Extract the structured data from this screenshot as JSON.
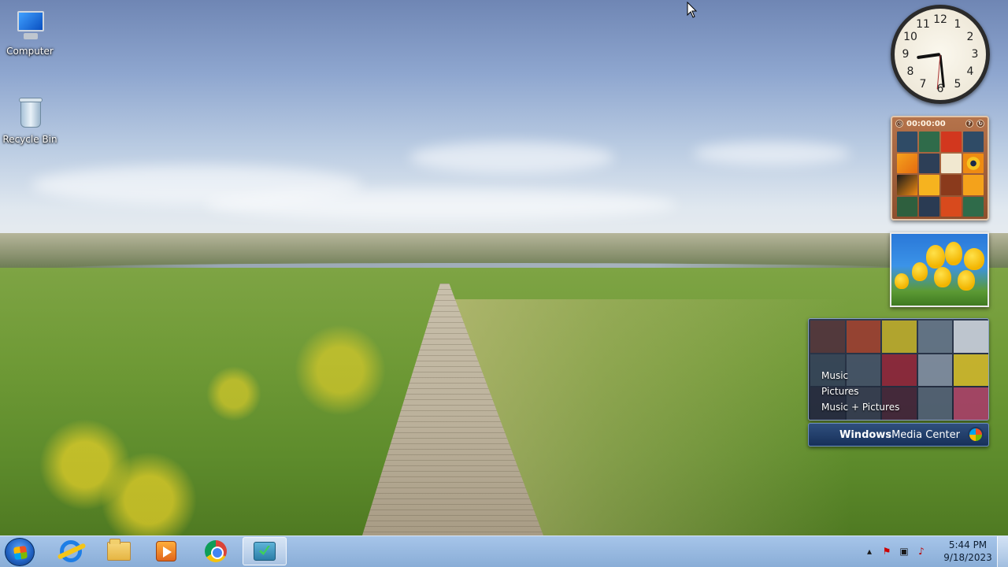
{
  "desktop": {
    "icons": [
      {
        "label": "Computer",
        "icon": "computer-icon"
      },
      {
        "label": "Recycle Bin",
        "icon": "recycle-bin-icon"
      }
    ]
  },
  "gadgets": {
    "clock": {
      "numbers": [
        "12",
        "1",
        "2",
        "3",
        "4",
        "5",
        "6",
        "7",
        "8",
        "9",
        "10",
        "11"
      ]
    },
    "puzzle": {
      "timer": "00:00:00"
    },
    "media_center": {
      "menu": [
        "Music",
        "Pictures",
        "Music + Pictures"
      ],
      "brand_strong": "Windows",
      "brand_rest": " Media Center"
    }
  },
  "taskbar": {
    "buttons": [
      {
        "name": "internet-explorer",
        "icon": "internet-explorer-icon"
      },
      {
        "name": "file-explorer",
        "icon": "folder-icon"
      },
      {
        "name": "media-player",
        "icon": "media-player-icon"
      },
      {
        "name": "chrome",
        "icon": "chrome-icon"
      },
      {
        "name": "active-app",
        "icon": "app-icon",
        "active": true
      }
    ],
    "tray": {
      "icons": [
        "show-hidden-icons-icon",
        "action-center-icon",
        "network-icon",
        "volume-muted-icon"
      ],
      "time": "5:44 PM",
      "date": "9/18/2023"
    }
  },
  "colors": {
    "taskbar": "#9fbfe3",
    "wmc_bar": "#17305a"
  }
}
